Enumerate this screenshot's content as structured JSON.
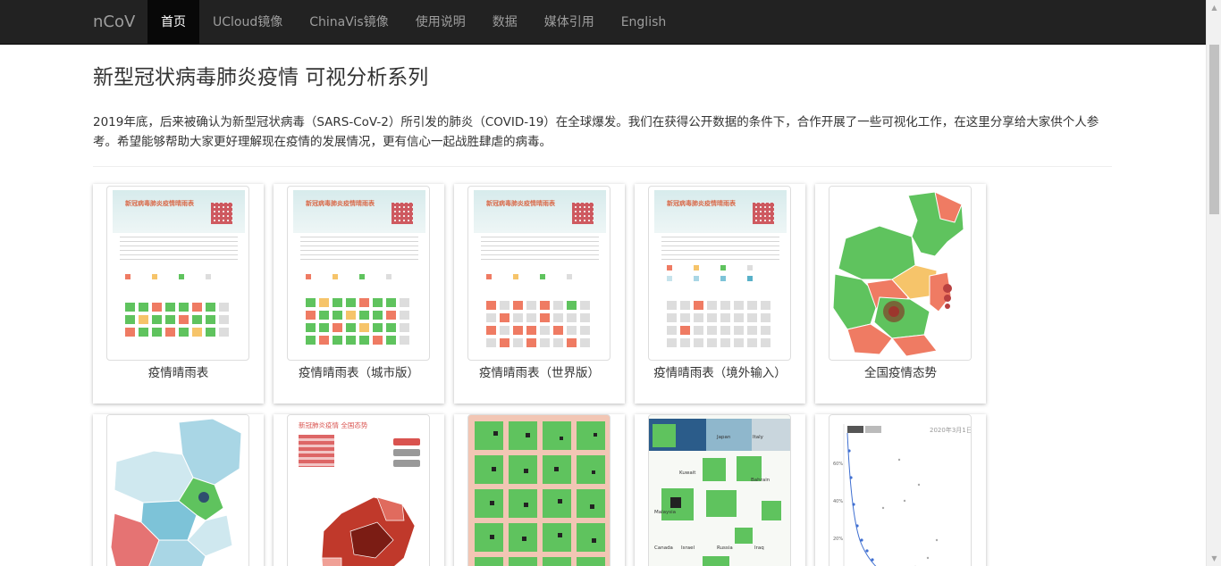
{
  "nav": {
    "brand": "nCoV",
    "items": [
      {
        "label": "首页",
        "active": true
      },
      {
        "label": "UCloud镜像"
      },
      {
        "label": "ChinaVis镜像"
      },
      {
        "label": "使用说明"
      },
      {
        "label": "数据"
      },
      {
        "label": "媒体引用"
      },
      {
        "label": "English"
      }
    ]
  },
  "main": {
    "title": "新型冠状病毒肺炎疫情 可视分析系列",
    "intro": "2019年底，后来被确认为新型冠状病毒（SARS-CoV-2）所引发的肺炎（COVID-19）在全球爆发。我们在获得公开数据的条件下，合作开展了一些可视化工作，在这里分享给大家供个人参考。希望能够帮助大家更好理解现在疫情的发展情况，更有信心一起战胜肆虐的病毒。"
  },
  "cards": [
    {
      "caption": "疫情晴雨表",
      "thumb_title": "新冠病毒肺炎疫情晴雨表"
    },
    {
      "caption": "疫情晴雨表（城市版）",
      "thumb_title": "新冠病毒肺炎疫情晴雨表"
    },
    {
      "caption": "疫情晴雨表（世界版）",
      "thumb_title": "新冠病毒肺炎疫情晴雨表"
    },
    {
      "caption": "疫情晴雨表（境外输入）",
      "thumb_title": "新冠病毒肺炎疫情晴雨表"
    },
    {
      "caption": "全国疫情态势"
    }
  ],
  "row2": {
    "card7_title": "新冠肺炎疫情 全国态势",
    "card10_labels": [
      "Japan",
      "Italy",
      "Kuwait",
      "Bahrain",
      "Malaysia",
      "Canada",
      "Israel",
      "Russia",
      "Iraq"
    ],
    "card11_date": "2020年3月1日",
    "card11_ticks": [
      "60%",
      "40%",
      "20%"
    ]
  },
  "colors": {
    "navbar": "#222222",
    "rise": "#ef7b63",
    "flat": "#f6c46a",
    "fall": "#5fc35e",
    "map_red": "#ef7b63",
    "map_green": "#5fc35e",
    "map_blue": "#a9d6e5"
  }
}
